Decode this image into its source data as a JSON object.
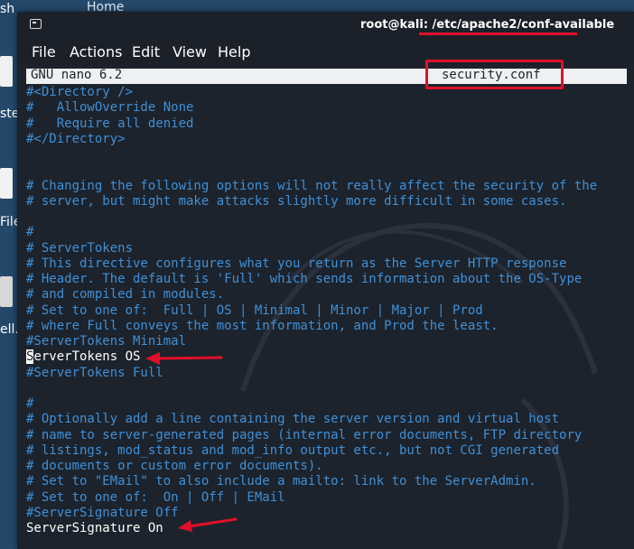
{
  "desktop": {
    "labels": [
      "sh",
      "Home",
      "ste",
      "File",
      "ell."
    ]
  },
  "window": {
    "title": "root@kali: /etc/apache2/conf-available"
  },
  "menu": [
    "File",
    "Actions",
    "Edit",
    "View",
    "Help"
  ],
  "nano": {
    "version": "GNU nano 6.2",
    "filename": "security.conf"
  },
  "lines": [
    {
      "text": "#<Directory />",
      "type": "comment"
    },
    {
      "text": "#   AllowOverride None",
      "type": "comment"
    },
    {
      "text": "#   Require all denied",
      "type": "comment"
    },
    {
      "text": "#</Directory>",
      "type": "comment"
    },
    {
      "text": "",
      "type": "blank"
    },
    {
      "text": "",
      "type": "blank"
    },
    {
      "text": "# Changing the following options will not really affect the security of the",
      "type": "comment"
    },
    {
      "text": "# server, but might make attacks slightly more difficult in some cases.",
      "type": "comment"
    },
    {
      "text": "",
      "type": "blank"
    },
    {
      "text": "#",
      "type": "comment"
    },
    {
      "text": "# ServerTokens",
      "type": "comment"
    },
    {
      "text": "# This directive configures what you return as the Server HTTP response",
      "type": "comment"
    },
    {
      "text": "# Header. The default is 'Full' which sends information about the OS-Type",
      "type": "comment"
    },
    {
      "text": "# and compiled in modules.",
      "type": "comment"
    },
    {
      "text": "# Set to one of:  Full | OS | Minimal | Minor | Major | Prod",
      "type": "comment"
    },
    {
      "text": "# where Full conveys the most information, and Prod the least.",
      "type": "comment"
    },
    {
      "text": "#ServerTokens Minimal",
      "type": "comment"
    },
    {
      "text": "ServerTokens OS",
      "type": "active"
    },
    {
      "text": "#ServerTokens Full",
      "type": "comment"
    },
    {
      "text": "",
      "type": "blank"
    },
    {
      "text": "#",
      "type": "comment"
    },
    {
      "text": "# Optionally add a line containing the server version and virtual host",
      "type": "comment"
    },
    {
      "text": "# name to server-generated pages (internal error documents, FTP directory",
      "type": "comment"
    },
    {
      "text": "# listings, mod_status and mod_info output etc., but not CGI generated",
      "type": "comment"
    },
    {
      "text": "# documents or custom error documents).",
      "type": "comment"
    },
    {
      "text": "# Set to \"EMail\" to also include a mailto: link to the ServerAdmin.",
      "type": "comment"
    },
    {
      "text": "# Set to one of:  On | Off | EMail",
      "type": "comment"
    },
    {
      "text": "#ServerSignature Off",
      "type": "comment"
    },
    {
      "text": "ServerSignature On",
      "type": "active"
    }
  ],
  "colors": {
    "comment": "#3f8fd6",
    "text": "#ffffff",
    "background": "#1d232c",
    "annotation": "#e0102a"
  }
}
